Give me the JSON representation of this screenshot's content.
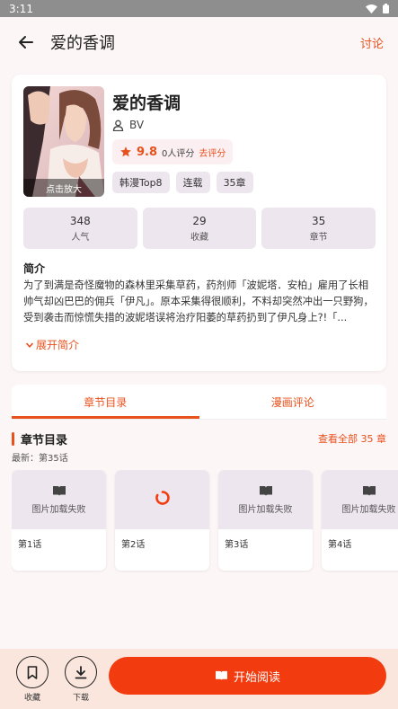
{
  "status_bar": {
    "time": "3:11"
  },
  "app_bar": {
    "title": "爱的香调",
    "action_label": "讨论"
  },
  "comic": {
    "title": "爱的香调",
    "author": "BV",
    "cover_zoom_label": "点击放大",
    "rating": "9.8",
    "rating_count": "0人评分",
    "rate_link": "去评分",
    "tags": [
      "韩漫Top8",
      "连载",
      "35章"
    ]
  },
  "stats": [
    {
      "value": "348",
      "label": "人气"
    },
    {
      "value": "29",
      "label": "收藏"
    },
    {
      "value": "35",
      "label": "章节"
    }
  ],
  "synopsis": {
    "heading": "简介",
    "text": "为了到满是奇怪魔物的森林里采集草药，药剂师「波妮塔．安柏」雇用了长相帅气却凶巴巴的佣兵「伊凡」。原本采集得很顺利，不料却突然冲出一只野狗，受到袭击而惊慌失措的波妮塔误将治疗阳萎的草药扔到了伊凡身上?!「...",
    "expand_label": "展开简介"
  },
  "tabs": [
    {
      "label": "章节目录"
    },
    {
      "label": "漫画评论"
    }
  ],
  "chapters": {
    "heading": "章节目录",
    "latest": "最新：第35话",
    "view_all": "查看全部 35 章",
    "items": [
      {
        "name": "第1话",
        "status": "图片加载失败"
      },
      {
        "name": "第2话",
        "status": ""
      },
      {
        "name": "第3话",
        "status": "图片加载失败"
      },
      {
        "name": "第4话",
        "status": "图片加载失败"
      }
    ]
  },
  "bottom_bar": {
    "favorite_label": "收藏",
    "download_label": "下载",
    "read_label": "开始阅读"
  },
  "colors": {
    "accent": "#e8501c",
    "read_button": "#f23b0f",
    "chip_bg": "#eee6ef",
    "bottom_bar_bg": "#fbe6de"
  }
}
